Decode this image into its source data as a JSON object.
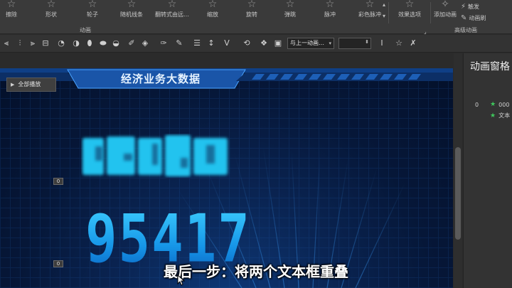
{
  "ribbon": {
    "effects": [
      {
        "label": "擦除",
        "icon": "star-icon"
      },
      {
        "label": "形状",
        "icon": "star-icon"
      },
      {
        "label": "轮子",
        "icon": "star-icon"
      },
      {
        "label": "随机线条",
        "icon": "star-icon"
      },
      {
        "label": "翻转式由远…",
        "icon": "star-icon"
      },
      {
        "label": "缩放",
        "icon": "star-icon"
      },
      {
        "label": "旋转",
        "icon": "star-icon"
      },
      {
        "label": "弹跳",
        "icon": "star-icon"
      },
      {
        "label": "脉冲",
        "icon": "star-icon"
      },
      {
        "label": "彩色脉冲",
        "icon": "star-icon"
      }
    ],
    "effect_options_label": "效果选项",
    "add_animation_label": "添加动画",
    "trigger_label": "触发",
    "animation_painter_label": "动画刷",
    "group_animation_label": "动画",
    "group_advanced_label": "高级动画"
  },
  "toolbar": {
    "dropdown_value": "与上一动画…",
    "spin_value": ""
  },
  "slide": {
    "title": "经济业务大数据",
    "number": "95417",
    "tag_top": "0",
    "tag_bottom": "0"
  },
  "subtitle": "最后一步：将两个文本框重叠",
  "pane": {
    "title": "动画窗格",
    "play_all_label": "全部播放",
    "items": [
      {
        "index": "0",
        "label": "000"
      },
      {
        "index": "",
        "label": "文本"
      }
    ]
  },
  "colors": {
    "slide_bg": "#061738",
    "number_color": "#1ab2f5",
    "blur_color": "#22c3ef",
    "pane_star": "#3fc85c"
  }
}
